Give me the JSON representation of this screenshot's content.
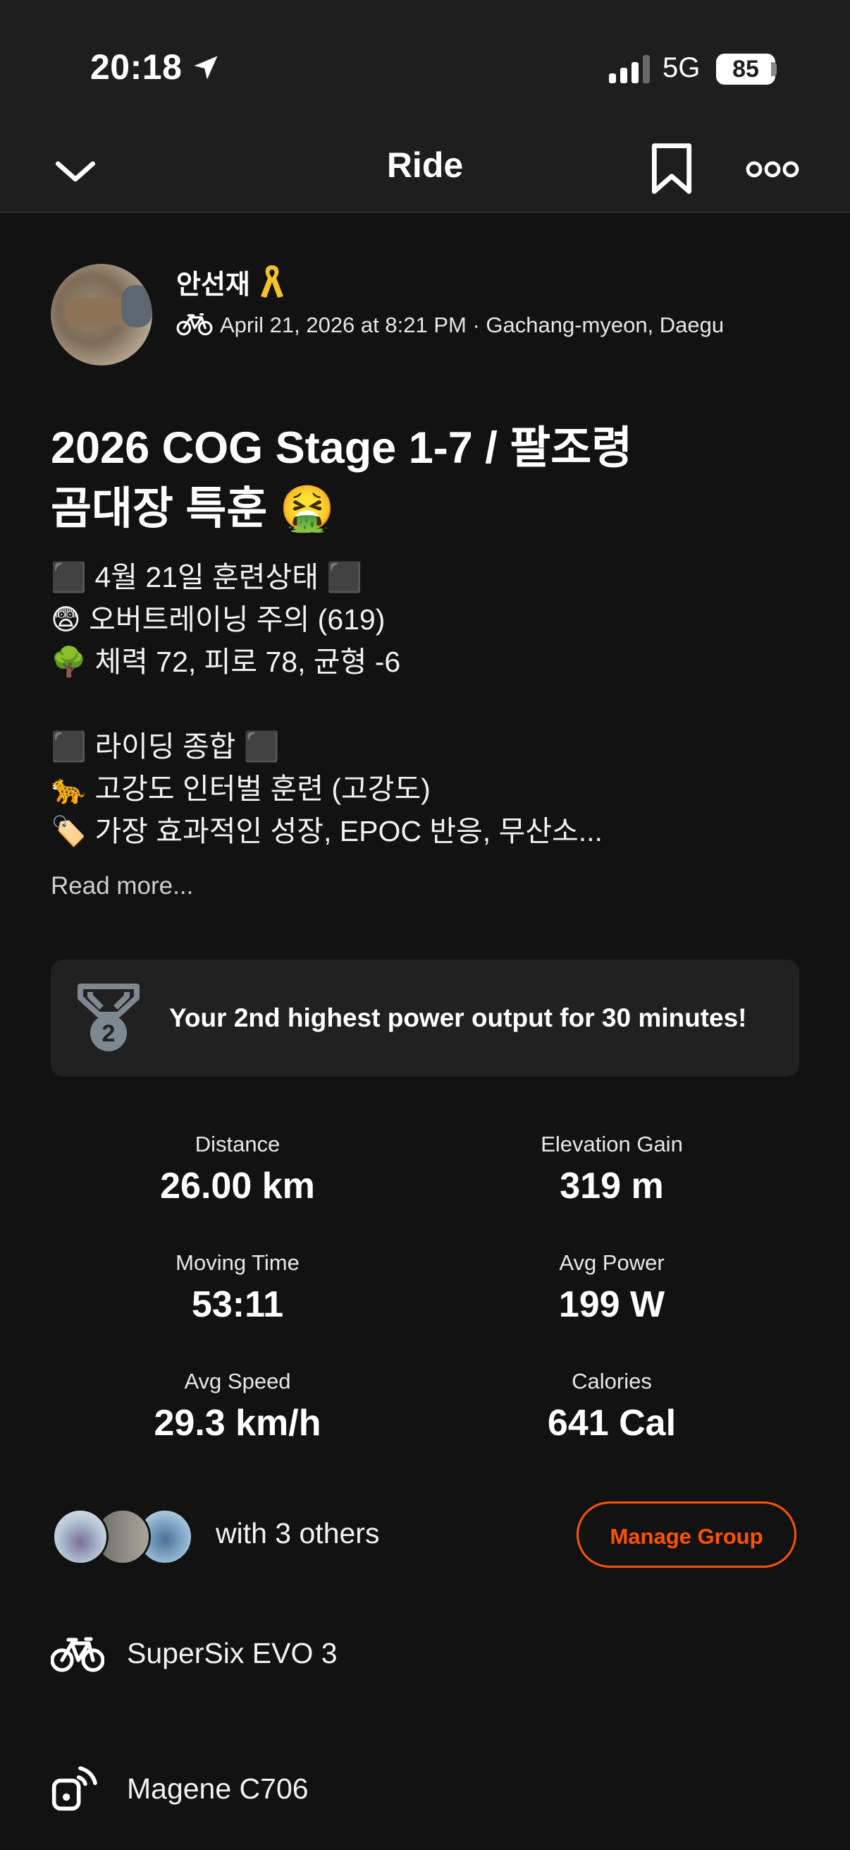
{
  "status_bar": {
    "time": "20:18",
    "network": "5G",
    "battery": "85"
  },
  "nav": {
    "title": "Ride"
  },
  "athlete": {
    "name": "안선재",
    "activity_meta": "April 21, 2026 at 8:21 PM · Gachang-myeon, Daegu"
  },
  "activity": {
    "title_line1": "2026 COG Stage 1-7 / 팔조령",
    "title_line2": "곰대장 특훈 🤮",
    "description_lines": [
      "⬛ 4월 21일 훈련상태 ⬛",
      "😨 오버트레이닝 주의 (619)",
      "🌳 체력 72, 피로 78, 균형 -6",
      "",
      "⬛ 라이딩 종합 ⬛",
      "🐆 고강도 인터벌 훈련 (고강도)",
      "🏷️ 가장 효과적인 성장, EPOC 반응, 무산소..."
    ],
    "read_more": "Read more..."
  },
  "achievement": {
    "medal_rank": "2",
    "text": "Your 2nd highest power output for 30 minutes!"
  },
  "stats": [
    {
      "label": "Distance",
      "value": "26.00 km"
    },
    {
      "label": "Elevation Gain",
      "value": "319 m"
    },
    {
      "label": "Moving Time",
      "value": "53:11"
    },
    {
      "label": "Avg Power",
      "value": "199 W"
    },
    {
      "label": "Avg Speed",
      "value": "29.3 km/h"
    },
    {
      "label": "Calories",
      "value": "641 Cal"
    }
  ],
  "group": {
    "text": "with 3 others",
    "manage_button": "Manage Group"
  },
  "gear": {
    "bike": "SuperSix EVO 3",
    "device": "Magene C706"
  },
  "colors": {
    "accent": "#fc5200",
    "background": "#121212",
    "header": "#1e1e1e",
    "card": "#212121"
  }
}
